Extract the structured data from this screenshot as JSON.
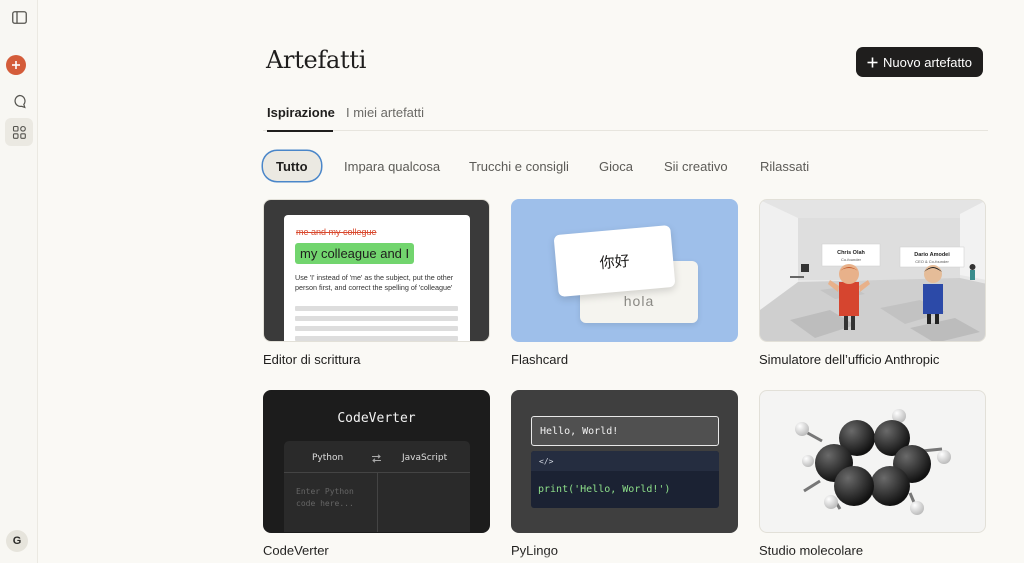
{
  "sidebar": {
    "toggle_icon": "sidebar-toggle-icon",
    "new_icon": "plus-icon",
    "chats_icon": "chat-bubble-icon",
    "artifacts_icon": "artifacts-grid-icon",
    "avatar_initial": "G"
  },
  "header": {
    "title": "Artefatti",
    "new_button_label": "Nuovo artefatto"
  },
  "tabs": [
    {
      "label": "Ispirazione",
      "active": true
    },
    {
      "label": "I miei artefatti",
      "active": false
    }
  ],
  "filters": [
    {
      "label": "Tutto",
      "active": true
    },
    {
      "label": "Impara qualcosa"
    },
    {
      "label": "Trucchi e consigli"
    },
    {
      "label": "Gioca"
    },
    {
      "label": "Sii creativo"
    },
    {
      "label": "Rilassati"
    }
  ],
  "cards": [
    {
      "title": "Editor di scrittura",
      "preview": {
        "struck": "me and my collegue",
        "highlight": "my colleague and I",
        "note": "Use 'I' instead of 'me' as the subject, put the other person first, and correct the spelling of 'colleague'"
      }
    },
    {
      "title": "Flashcard",
      "preview": {
        "front": "你好",
        "back": "hola"
      }
    },
    {
      "title": "Simulatore dell’ufficio Anthropic",
      "preview": {
        "person1_name": "Chris Olah",
        "person1_role": "Co-founder",
        "person2_name": "Dario Amodei",
        "person2_role": "CEO & Co-founder"
      }
    },
    {
      "title": "CodeVerter",
      "preview": {
        "heading": "CodeVerter",
        "source_lang": "Python",
        "target_lang": "JavaScript",
        "swap_icon": "swap-arrows-icon",
        "placeholder": "Enter Python code here..."
      }
    },
    {
      "title": "PyLingo",
      "preview": {
        "output": "Hello, World!",
        "tab": "</>",
        "code": "print('Hello, World!')"
      }
    },
    {
      "title": "Studio molecolare",
      "preview": {}
    }
  ],
  "colors": {
    "background": "#faf9f5",
    "accent": "#d45c3a",
    "primary_button": "#1f1e1d",
    "focus_ring": "#4a86c9",
    "flashcard_bg": "#9ebfea",
    "highlight_green": "#72d56e"
  }
}
